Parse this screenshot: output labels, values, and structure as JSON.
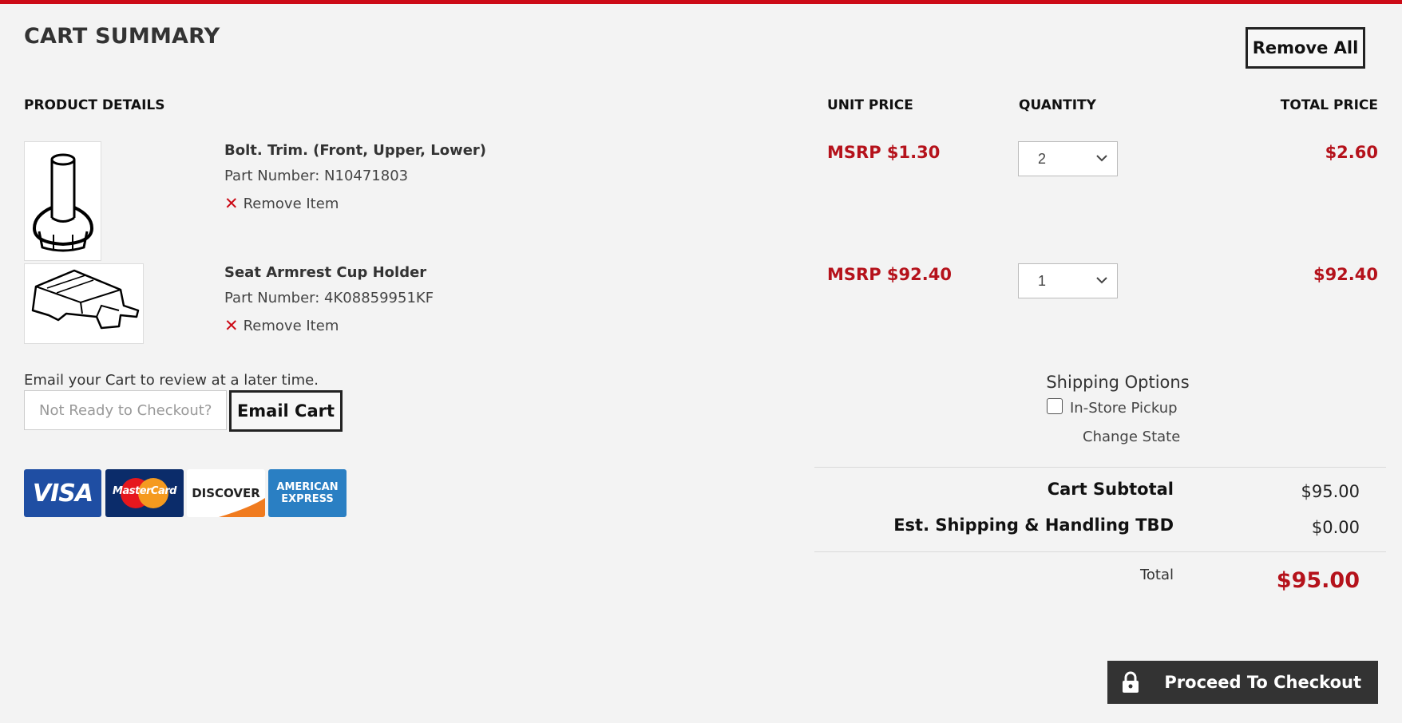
{
  "page": {
    "title": "CART SUMMARY",
    "remove_all_label": "Remove All",
    "accent_color": "#cc0a16"
  },
  "columns": {
    "product_details": "PRODUCT DETAILS",
    "unit_price": "UNIT PRICE",
    "quantity": "QUANTITY",
    "total_price": "TOTAL PRICE"
  },
  "items": [
    {
      "name": "Bolt. Trim. (Front, Upper, Lower)",
      "part_number": "Part Number: N10471803",
      "remove_label": "Remove Item",
      "unit_price": "MSRP $1.30",
      "quantity": "2",
      "total_price": "$2.60",
      "image_icon": "bolt-part-icon"
    },
    {
      "name": "Seat Armrest Cup Holder",
      "part_number": "Part Number: 4K08859951KF",
      "remove_label": "Remove Item",
      "unit_price": "MSRP $92.40",
      "quantity": "1",
      "total_price": "$92.40",
      "image_icon": "cup-holder-part-icon"
    }
  ],
  "email_cart": {
    "note": "Email your Cart to review at a later time.",
    "placeholder": "Not Ready to Checkout?",
    "button_label": "Email Cart"
  },
  "payment_cards": {
    "visa": "VISA",
    "mastercard": "MasterCard",
    "discover": "DISCOVER",
    "amex_line1": "AMERICAN",
    "amex_line2": "EXPRESS"
  },
  "shipping": {
    "heading": "Shipping Options",
    "pickup_label": "In-Store Pickup",
    "pickup_checked": false,
    "change_state_label": "Change State"
  },
  "summary": {
    "subtotal_label": "Cart Subtotal",
    "subtotal_value": "$95.00",
    "shipping_label": "Est. Shipping & Handling TBD",
    "shipping_value": "$0.00",
    "total_label": "Total",
    "total_value": "$95.00"
  },
  "checkout": {
    "label": "Proceed To Checkout",
    "icon": "lock-icon"
  }
}
